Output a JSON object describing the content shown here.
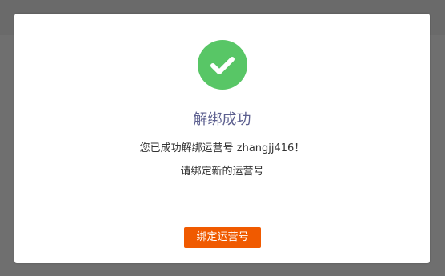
{
  "colors": {
    "overlay": "#6f6f6f",
    "dialog_background": "#ffffff",
    "success_green": "#58c666",
    "title_color": "#5c5f8f",
    "button_orange": "#f05a00"
  },
  "dialog": {
    "icon": "check-circle-icon",
    "title": "解绑成功",
    "message": "您已成功解绑运营号 zhangjj416！",
    "sub_message": "请绑定新的运营号",
    "button_label": "绑定运营号"
  }
}
